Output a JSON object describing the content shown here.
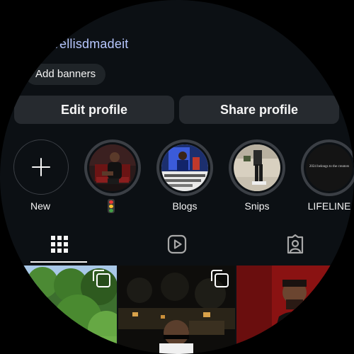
{
  "profile": {
    "link": "r.ee/ellisdmadeit",
    "add_banners_label": "Add banners"
  },
  "buttons": {
    "edit_profile": "Edit profile",
    "share_profile": "Share profile"
  },
  "highlights": [
    {
      "label": "New",
      "icon": "plus-icon"
    },
    {
      "label": "",
      "icon": "traffic-light-emoji"
    },
    {
      "label": "Blogs"
    },
    {
      "label": "Snips"
    },
    {
      "label": "LIFELINE",
      "cover_text": "2024 belongs to the creators"
    }
  ],
  "tabs": {
    "grid": "grid-icon",
    "reels": "reels-icon",
    "tagged": "tagged-icon"
  },
  "posts": [
    {
      "type": "nature photo",
      "multi": true
    },
    {
      "type": "night portrait",
      "multi": true
    },
    {
      "type": "red portrait",
      "multi": false
    }
  ],
  "colors": {
    "background": "#0c1014",
    "link": "#b7c7ff",
    "button": "#262a2f",
    "ring": "#3b3f45"
  }
}
